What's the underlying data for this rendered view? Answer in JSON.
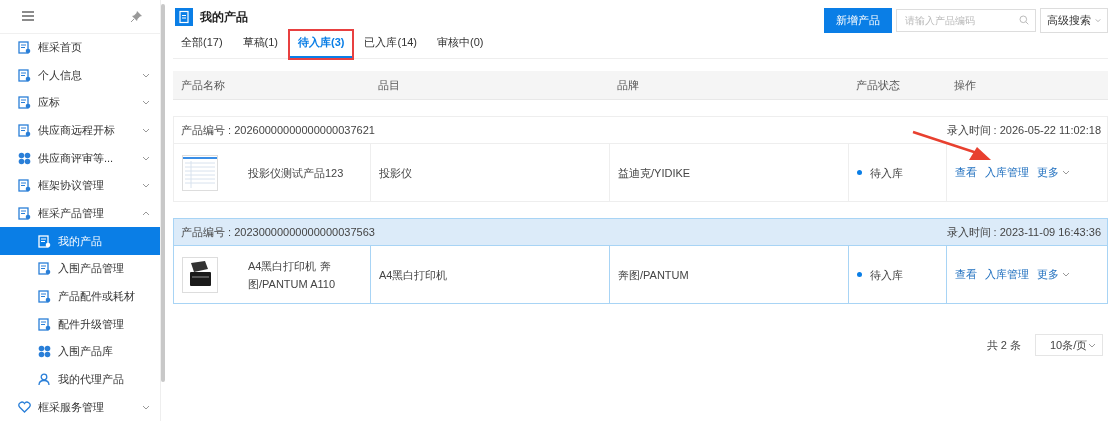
{
  "sidebar": {
    "items": [
      {
        "label": "框采首页",
        "selected": false
      },
      {
        "label": "个人信息",
        "selected": false,
        "expanded": false
      },
      {
        "label": "应标",
        "selected": false,
        "expanded": false
      },
      {
        "label": "供应商远程开标",
        "selected": false,
        "expanded": false
      },
      {
        "label": "供应商评审等...",
        "selected": false,
        "expanded": false
      },
      {
        "label": "框架协议管理",
        "selected": false,
        "expanded": false
      },
      {
        "label": "框采产品管理",
        "selected": false,
        "expanded": true,
        "children": [
          {
            "label": "我的产品",
            "selected": true
          },
          {
            "label": "入围产品管理",
            "selected": false
          },
          {
            "label": "产品配件或耗材",
            "selected": false
          },
          {
            "label": "配件升级管理",
            "selected": false
          },
          {
            "label": "入围产品库",
            "selected": false
          },
          {
            "label": "我的代理产品",
            "selected": false
          }
        ]
      },
      {
        "label": "框采服务管理",
        "selected": false,
        "expanded": false
      }
    ]
  },
  "page": {
    "title": "我的产品"
  },
  "tabs": [
    {
      "label": "全部(17)",
      "selected": false,
      "highlighted": false
    },
    {
      "label": "草稿(1)",
      "selected": false,
      "highlighted": false
    },
    {
      "label": "待入库(3)",
      "selected": true,
      "highlighted": true
    },
    {
      "label": "已入库(14)",
      "selected": false,
      "highlighted": false
    },
    {
      "label": "审核中(0)",
      "selected": false,
      "highlighted": false
    }
  ],
  "toolbar": {
    "add_button": "新增产品",
    "search": {
      "placeholder": "请输入产品编码"
    },
    "advanced_search": "高级搜索"
  },
  "table": {
    "columns": [
      "产品名称",
      "品目",
      "品牌",
      "产品状态",
      "操作"
    ],
    "rows": [
      {
        "code_label": "产品编号 : 20260000000000000037621",
        "time_label": "录入时间 : 2026-05-22 11:02:18",
        "kind": "screenshot",
        "name": "投影仪测试产品123",
        "category": "投影仪",
        "brand": "益迪克/YIDIKE",
        "status": "待入库",
        "selected": false,
        "actions": [
          {
            "label": "查看",
            "kind": "link",
            "pointed": false
          },
          {
            "label": "入库管理",
            "kind": "link",
            "pointed": true
          },
          {
            "label": "更多",
            "kind": "dropdown",
            "pointed": false
          }
        ]
      },
      {
        "code_label": "产品编号 : 20230000000000000037563",
        "time_label": "录入时间 : 2023-11-09 16:43:36",
        "kind": "printer",
        "name": "A4黑白打印机 奔图/PANTUM A110",
        "category": "A4黑白打印机",
        "brand": "奔图/PANTUM",
        "status": "待入库",
        "selected": true,
        "actions": [
          {
            "label": "查看",
            "kind": "link",
            "pointed": false
          },
          {
            "label": "入库管理",
            "kind": "link",
            "pointed": false
          },
          {
            "label": "更多",
            "kind": "dropdown",
            "pointed": false
          }
        ]
      }
    ]
  },
  "pagination": {
    "total": "共 2 条",
    "page_size": "10条/页"
  }
}
